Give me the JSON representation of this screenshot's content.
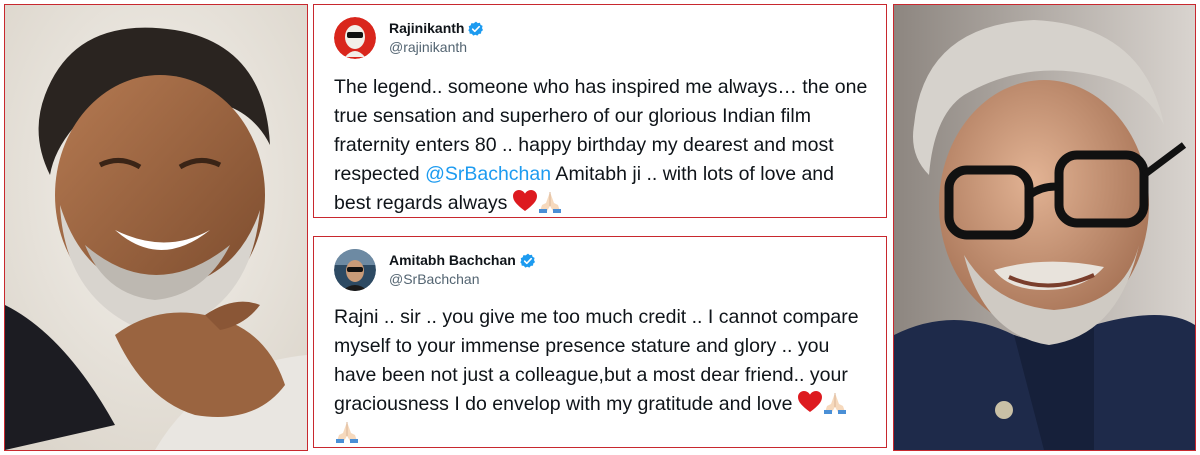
{
  "tweets": [
    {
      "display_name": "Rajinikanth",
      "handle": "@rajinikanth",
      "verified": true,
      "text_before": "The legend.. someone who has inspired me always… the one true sensation and superhero of our glorious Indian film fraternity enters 80 .. happy birthday my dearest and most respected ",
      "mention": "@SrBachchan",
      "text_after": " Amitabh ji .. with lots of love and best regards always ",
      "emojis": [
        "red-heart",
        "folded-hands"
      ]
    },
    {
      "display_name": "Amitabh Bachchan",
      "handle": "@SrBachchan",
      "verified": true,
      "text_before": "Rajni .. sir .. you give me too much credit .. I cannot compare myself to your immense presence stature and glory  .. you have been not just a colleague,but a most dear friend..  your graciousness I do envelop with my gratitude and love ",
      "emojis": [
        "red-heart",
        "folded-hands",
        "folded-hands"
      ]
    }
  ],
  "photos": [
    {
      "subject": "smiling bearded man portrait",
      "icon": "portrait-photo"
    },
    {
      "subject": "smiling man with glasses portrait",
      "icon": "portrait-photo"
    }
  ],
  "colors": {
    "frame_border": "#c8282e",
    "verified_blue": "#1d9bf0",
    "mention_blue": "#1d9bf0",
    "text": "#0f1419",
    "handle_gray": "#536471"
  }
}
